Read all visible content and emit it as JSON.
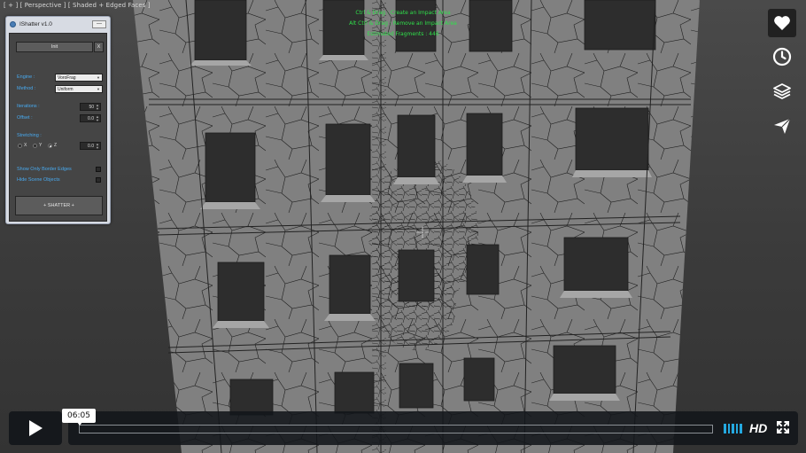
{
  "viewport": {
    "label": "[ + ] [ Perspective ] [ Shaded + Edged Faces ]"
  },
  "hints": [
    "Ctrl & Drag : Create an Impact Area",
    "Alt Ctrl & Drag : Remove an Impact Area",
    "Estimated Fragments : 446"
  ],
  "panel": {
    "title": "IShatter v1.0",
    "close_label": "—",
    "reset_label": "Init",
    "reset_side_label": "X",
    "engine_label": "Engine :",
    "engine_value": "VoroFrag",
    "method_label": "Method :",
    "method_value": "Uniform",
    "iterations_label": "Iterations :",
    "iterations_value": "50",
    "offset_label": "Offset :",
    "offset_value": "0.0",
    "stretching_label": "Stretching :",
    "axis_x": "X",
    "axis_y": "Y",
    "axis_z": "Z",
    "stretch_value": "0.0",
    "border_edges_label": "Show Only Border Edges",
    "hide_scene_label": "Hide Scene Objects",
    "shatter_label": "+ SHATTER +"
  },
  "side_icons": [
    "heart-icon",
    "clock-icon",
    "layers-icon",
    "send-icon"
  ],
  "player": {
    "time": "06:05",
    "progress": 0.0,
    "hd_label": "HD",
    "accent": "#24a9e0"
  }
}
